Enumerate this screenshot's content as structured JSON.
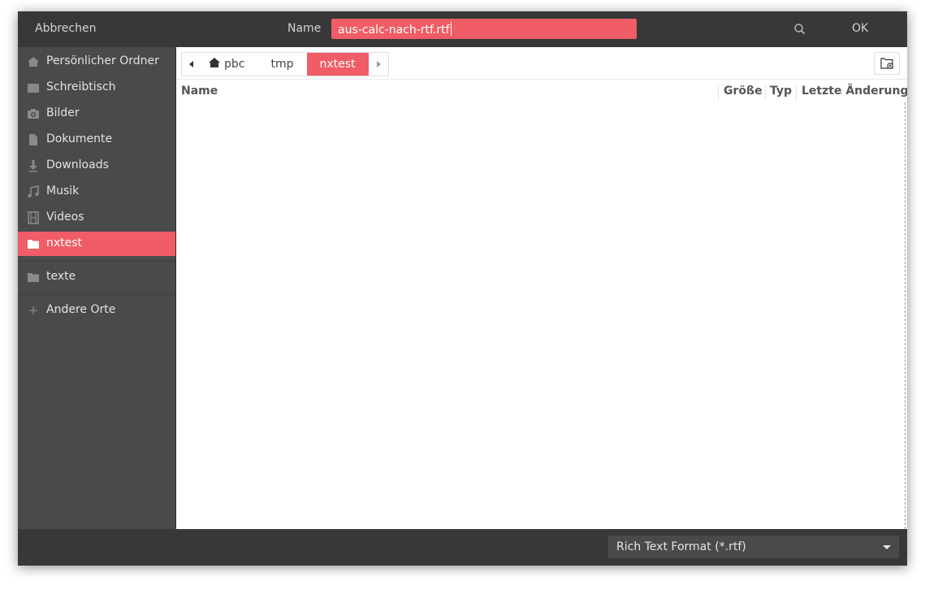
{
  "headerbar": {
    "cancel_label": "Abbrechen",
    "name_label": "Name",
    "filename_value": "aus-calc-nach-rtf.rtf",
    "search_icon": "search-icon",
    "ok_label": "OK"
  },
  "sidebar": {
    "items": [
      {
        "label": "Persönlicher Ordner",
        "icon": "home-icon"
      },
      {
        "label": "Schreibtisch",
        "icon": "desktop-folder-icon"
      },
      {
        "label": "Bilder",
        "icon": "camera-icon"
      },
      {
        "label": "Dokumente",
        "icon": "document-icon"
      },
      {
        "label": "Downloads",
        "icon": "download-icon"
      },
      {
        "label": "Musik",
        "icon": "music-icon"
      },
      {
        "label": "Videos",
        "icon": "film-icon"
      },
      {
        "label": "nxtest",
        "icon": "folder-icon",
        "active": true
      },
      {
        "label": "texte",
        "icon": "folder-icon"
      },
      {
        "label": "Andere Orte",
        "icon": "plus-icon"
      }
    ]
  },
  "pathbar": {
    "crumbs": [
      "pbc",
      "tmp",
      "nxtest"
    ],
    "active_crumb": "nxtest",
    "new_folder_icon": "new-folder-icon"
  },
  "filelist": {
    "columns": [
      "Name",
      "Größe",
      "Typ",
      "Letzte Änderung"
    ],
    "rows": []
  },
  "footer": {
    "filter_selected": "Rich Text Format (*.rtf)"
  },
  "colors": {
    "accent": "#f05d66",
    "header_bg": "#383838",
    "sidebar_bg": "#4a4a4a"
  }
}
